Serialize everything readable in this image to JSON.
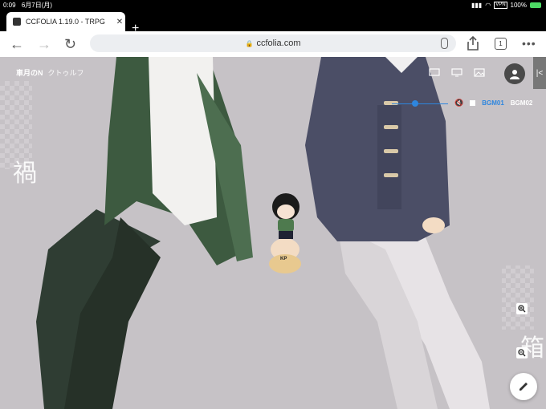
{
  "status": {
    "time": "0:09",
    "date": "6月7日(月)",
    "vpn": "VPN",
    "battery": "100%"
  },
  "tab": {
    "title": "CCFOLIA 1.19.0 - TRPG",
    "close": "✕",
    "new_tab": "+"
  },
  "toolbar": {
    "url": "ccfolia.com",
    "tab_count": "1"
  },
  "room": {
    "name": "車月のN",
    "subtitle": "クトゥルフ"
  },
  "bgm": {
    "track1": "BGM01",
    "track2": "BGM02"
  },
  "deco": {
    "left": "禍",
    "right": "箱"
  },
  "character": {
    "label": "KP"
  },
  "colors": {
    "accent": "#2e86de",
    "background": "#c6c2c6",
    "jacket_green": "#3d5a40",
    "coat_navy": "#4b4e66"
  }
}
